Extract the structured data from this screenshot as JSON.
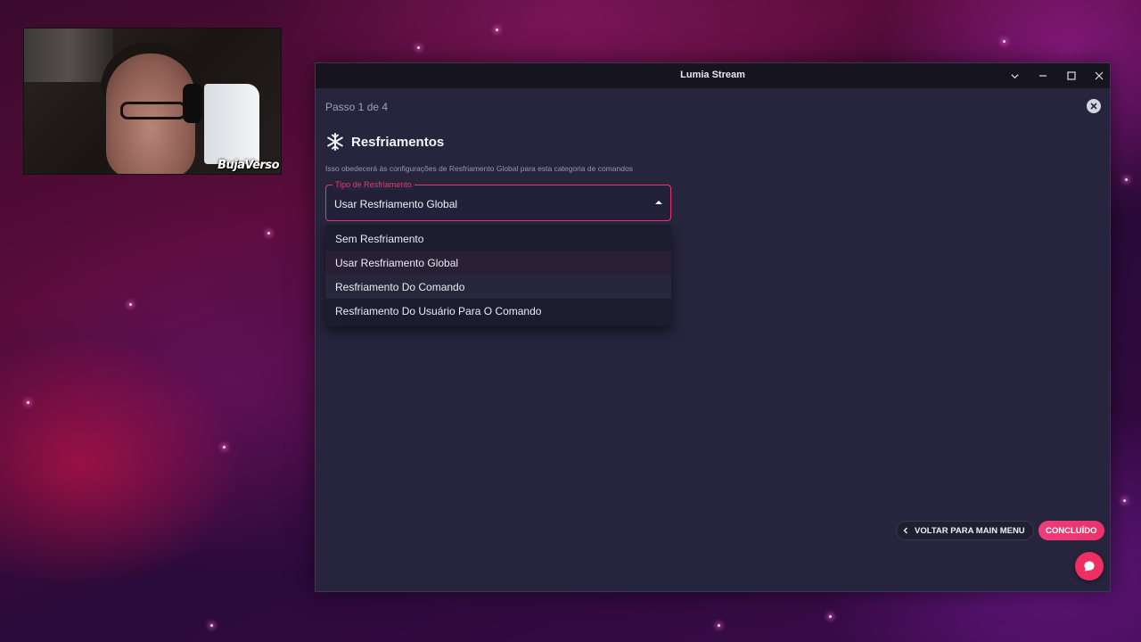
{
  "webcam": {
    "overlay_tag": "BujaVerso"
  },
  "window": {
    "title": "Lumia Stream",
    "controls": {
      "collapse_icon": "chevron-down-icon",
      "minimize_icon": "minimize-icon",
      "maximize_icon": "maximize-icon",
      "close_icon": "close-icon"
    }
  },
  "wizard": {
    "step": "Passo 1 de 4",
    "close_icon": "close-circle-icon",
    "section": {
      "icon": "snowflake-icon",
      "title": "Resfriamentos",
      "description": "Isso obedecerá às configurações de Resfriamento Global para esta categoria de comandos"
    },
    "cooldown_select": {
      "label": "Tipo de Resfriamento",
      "value": "Usar Resfriamento Global",
      "accent_color": "#e8376f",
      "options": [
        "Sem Resfriamento",
        "Usar Resfriamento Global",
        "Resfriamento Do Comando",
        "Resfriamento Do Usuário Para O Comando"
      ],
      "selected_index": 1,
      "hovered_index": 2
    }
  },
  "footer": {
    "back_label": "VOLTAR PARA MAIN MENU",
    "done_label": "CONCLUÍDO",
    "done_color": "#ef3d7c",
    "chat_icon": "chat-bubble-icon"
  }
}
